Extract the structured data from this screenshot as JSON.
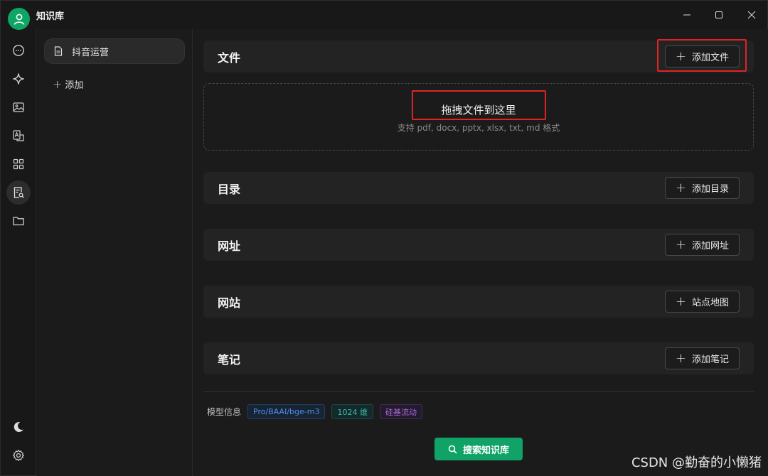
{
  "app": {
    "title": "知识库"
  },
  "window_controls": {
    "minimize": "minimize-icon",
    "maximize": "maximize-icon",
    "close": "close-icon"
  },
  "rail": {
    "icons": [
      "chat-icon",
      "sparkle-icon",
      "image-icon",
      "translate-icon",
      "apps-icon",
      "knowledge-search-icon",
      "folder-icon"
    ],
    "bottom": [
      "moon-icon",
      "gear-icon"
    ],
    "active": "knowledge-search-icon"
  },
  "kb_list": {
    "items": [
      {
        "label": "抖音运营",
        "icon": "document-icon"
      }
    ],
    "add_label": "添加"
  },
  "sections": {
    "files": {
      "title": "文件",
      "button": "添加文件"
    },
    "dropzone": {
      "title": "拖拽文件到这里",
      "subtitle": "支持 pdf, docx, pptx, xlsx, txt, md 格式"
    },
    "directory": {
      "title": "目录",
      "button": "添加目录"
    },
    "url": {
      "title": "网址",
      "button": "添加网址"
    },
    "website": {
      "title": "网站",
      "button": "站点地图"
    },
    "notes": {
      "title": "笔记",
      "button": "添加笔记"
    }
  },
  "model_info": {
    "label": "模型信息",
    "tags": [
      "Pro/BAAI/bge-m3",
      "1024 维",
      "硅基流动"
    ]
  },
  "search_button": "搜索知识库",
  "watermark": "CSDN @勤奋的小懒猪",
  "colors": {
    "accent": "#10a267",
    "highlight": "#e02424"
  }
}
